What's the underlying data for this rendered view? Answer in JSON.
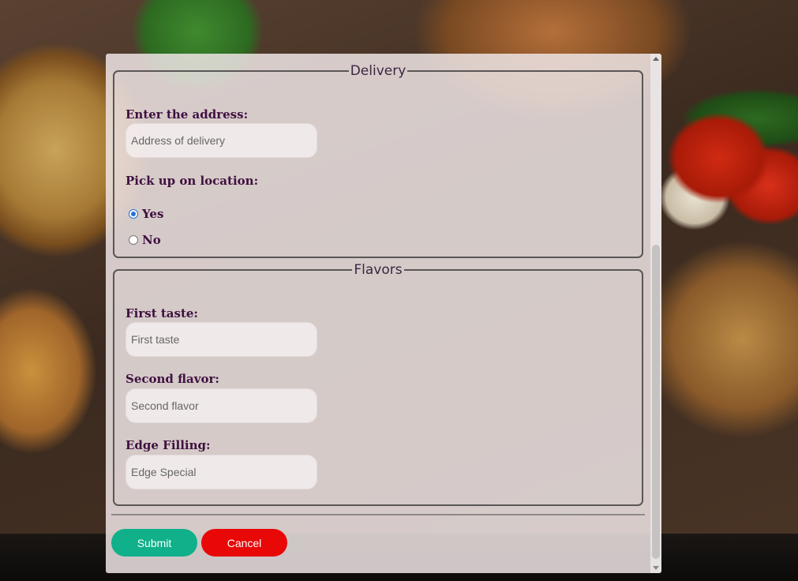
{
  "delivery": {
    "legend": "Delivery",
    "address_label": "Enter the address:",
    "address_placeholder": "Address of delivery",
    "address_value": "",
    "pickup_label": "Pick up on location:",
    "options": [
      {
        "label": "Yes",
        "checked": true
      },
      {
        "label": "No",
        "checked": false
      }
    ]
  },
  "flavors": {
    "legend": "Flavors",
    "first_label": "First taste:",
    "first_placeholder": "First taste",
    "second_label": "Second flavor:",
    "second_placeholder": "Second flavor",
    "edge_label": "Edge Filling:",
    "edge_placeholder": "Edge Special"
  },
  "actions": {
    "submit_label": "Submit",
    "cancel_label": "Cancel"
  },
  "colors": {
    "submit": "#0fb08a",
    "cancel": "#e80808",
    "label_text": "#3f1040",
    "radio_selected": "#2a6fd8"
  },
  "icons": {
    "scroll_up": "scroll-up-arrow-icon",
    "scroll_down": "scroll-down-arrow-icon"
  }
}
